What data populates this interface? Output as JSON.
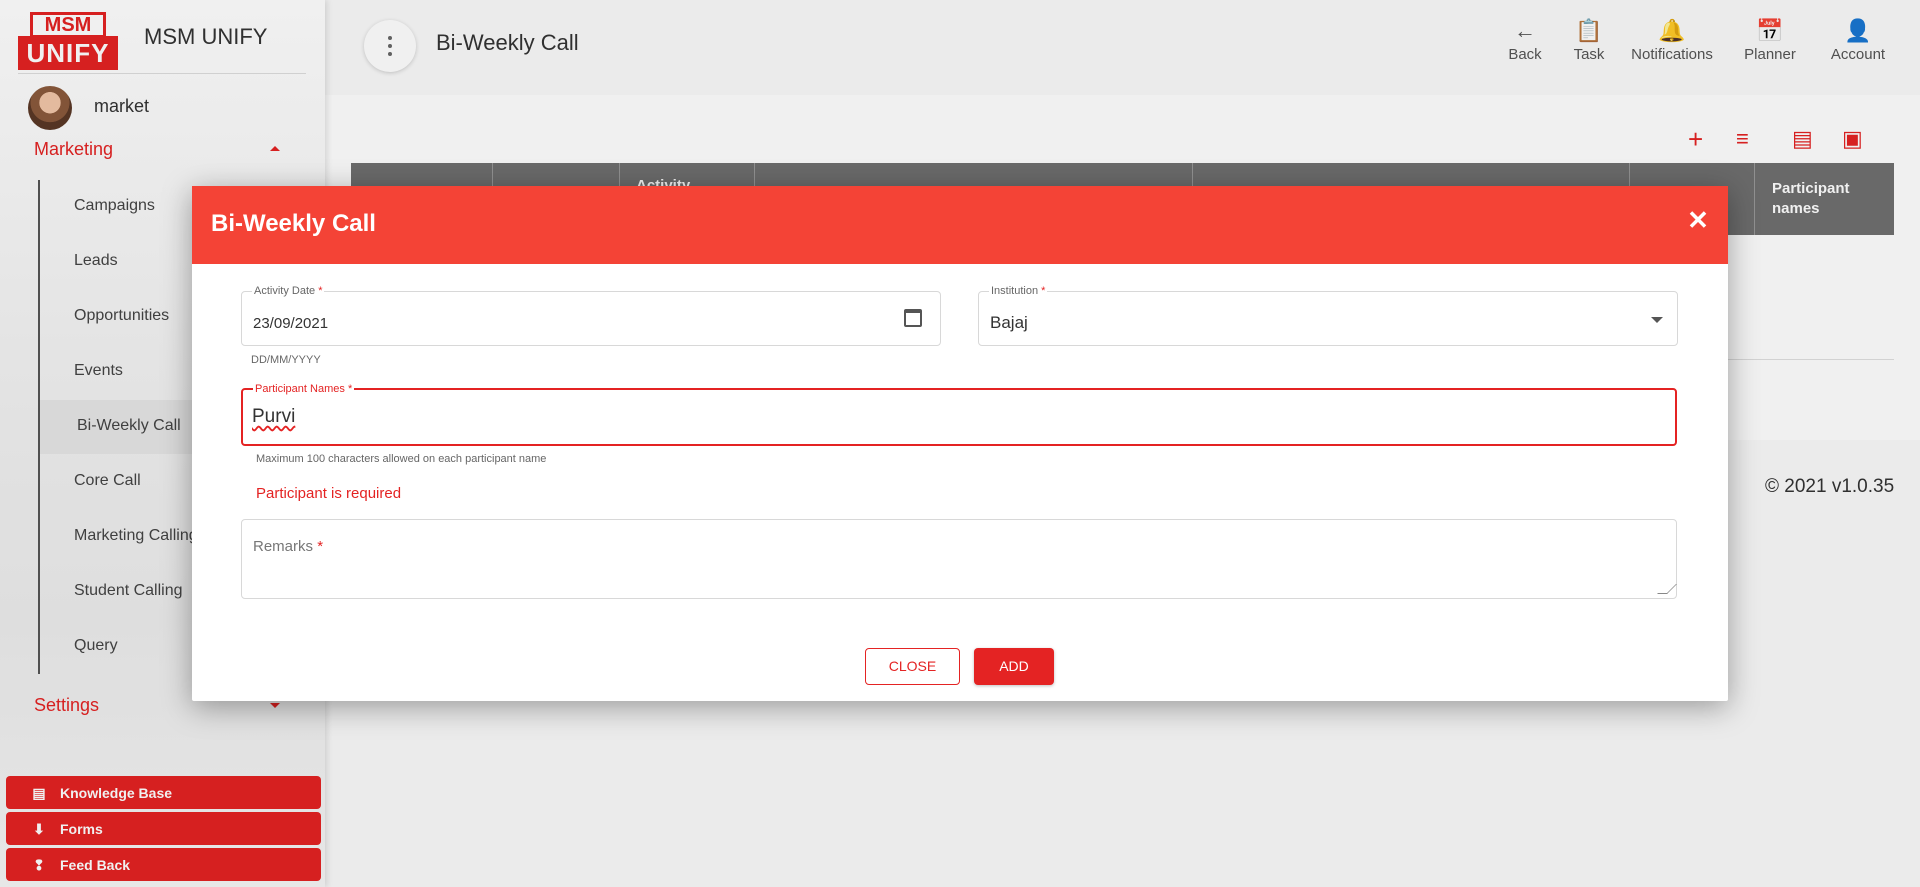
{
  "app": {
    "logo_top": "MSM",
    "logo_bottom": "UNIFY",
    "name": "MSM UNIFY",
    "user_name": "market"
  },
  "sidebar": {
    "section_marketing": "Marketing",
    "items": [
      {
        "label": "Campaigns"
      },
      {
        "label": "Leads"
      },
      {
        "label": "Opportunities"
      },
      {
        "label": "Events"
      },
      {
        "label": "Bi-Weekly Call"
      },
      {
        "label": "Core Call"
      },
      {
        "label": "Marketing Calling"
      },
      {
        "label": "Student Calling"
      },
      {
        "label": "Query"
      }
    ],
    "section_settings": "Settings",
    "buttons": [
      {
        "label": "Knowledge Base",
        "icon": "book-icon"
      },
      {
        "label": "Forms",
        "icon": "download-icon"
      },
      {
        "label": "Feed Back",
        "icon": "feedback-icon"
      }
    ]
  },
  "header": {
    "title": "Bi-Weekly Call",
    "nav": [
      {
        "label": "Back",
        "icon": "arrow-left-icon"
      },
      {
        "label": "Task",
        "icon": "clipboard-icon"
      },
      {
        "label": "Notifications",
        "icon": "bell-icon"
      },
      {
        "label": "Planner",
        "icon": "calendar-icon"
      },
      {
        "label": "Account",
        "icon": "person-icon"
      }
    ]
  },
  "table": {
    "headers": [
      "Activity",
      "Participant names"
    ]
  },
  "footer": {
    "copyright": "© 2021 v1.0.35"
  },
  "dialog": {
    "title": "Bi-Weekly Call",
    "activity_date": {
      "label": "Activity Date",
      "value": "23/09/2021",
      "hint": "DD/MM/YYYY"
    },
    "institution": {
      "label": "Institution",
      "value": "Bajaj"
    },
    "participants": {
      "label": "Participant Names",
      "value": "Purvi",
      "hint": "Maximum 100 characters allowed on each participant name",
      "error": "Participant is required"
    },
    "remarks": {
      "label": "Remarks",
      "value": ""
    },
    "required_mark": "*",
    "close_label": "CLOSE",
    "add_label": "ADD"
  },
  "colors": {
    "brand_red": "#e42323",
    "dialog_header": "#f44336",
    "table_header": "#707070"
  }
}
